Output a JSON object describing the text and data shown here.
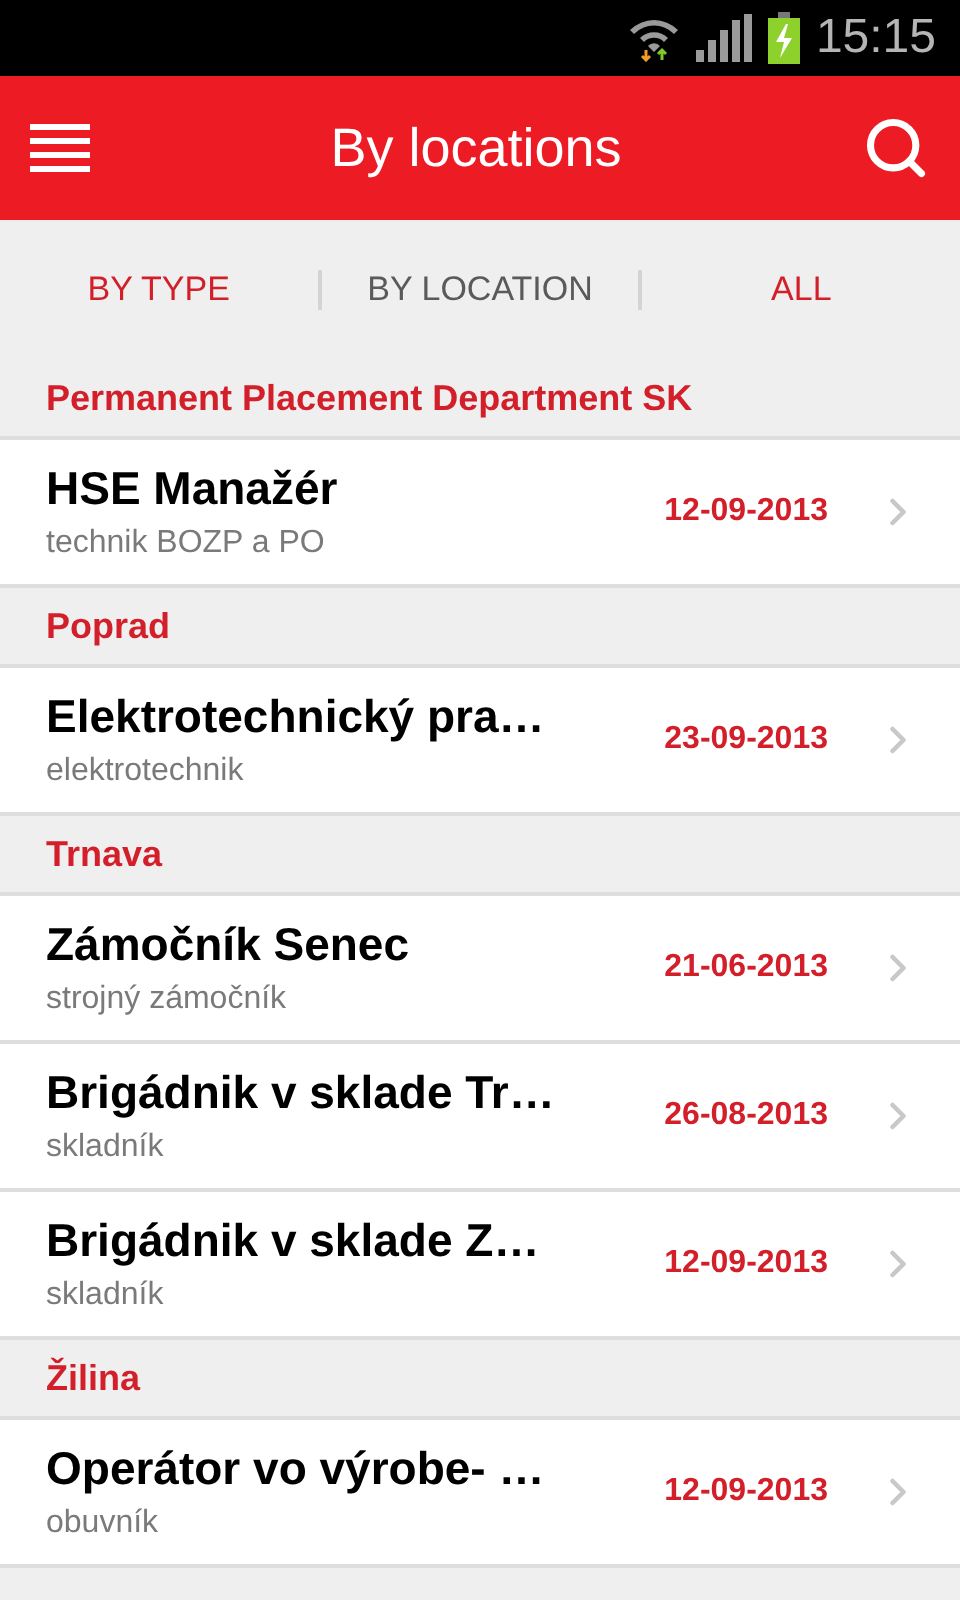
{
  "status_bar": {
    "time": "15:15"
  },
  "header": {
    "title": "By locations"
  },
  "tabs": [
    {
      "label": "BY TYPE",
      "selected": false
    },
    {
      "label": "BY LOCATION",
      "selected": true
    },
    {
      "label": "ALL",
      "selected": false
    }
  ],
  "sections": [
    {
      "title": "Permanent Placement Department SK",
      "jobs": [
        {
          "title": "HSE Manažér",
          "subtitle": "technik BOZP a PO",
          "date": "12-09-2013"
        }
      ]
    },
    {
      "title": "Poprad",
      "jobs": [
        {
          "title": "Elektrotechnický pra…",
          "subtitle": "elektrotechnik",
          "date": "23-09-2013"
        }
      ]
    },
    {
      "title": "Trnava",
      "jobs": [
        {
          "title": "Zámočník Senec",
          "subtitle": "strojný zámočník",
          "date": "21-06-2013"
        },
        {
          "title": "Brigádnik v sklade Tr…",
          "subtitle": "skladník",
          "date": "26-08-2013"
        },
        {
          "title": "Brigádnik v sklade Z…",
          "subtitle": "skladník",
          "date": "12-09-2013"
        }
      ]
    },
    {
      "title": "Žilina",
      "jobs": [
        {
          "title": "Operátor vo výrobe- …",
          "subtitle": "obuvník",
          "date": "12-09-2013"
        }
      ]
    }
  ]
}
